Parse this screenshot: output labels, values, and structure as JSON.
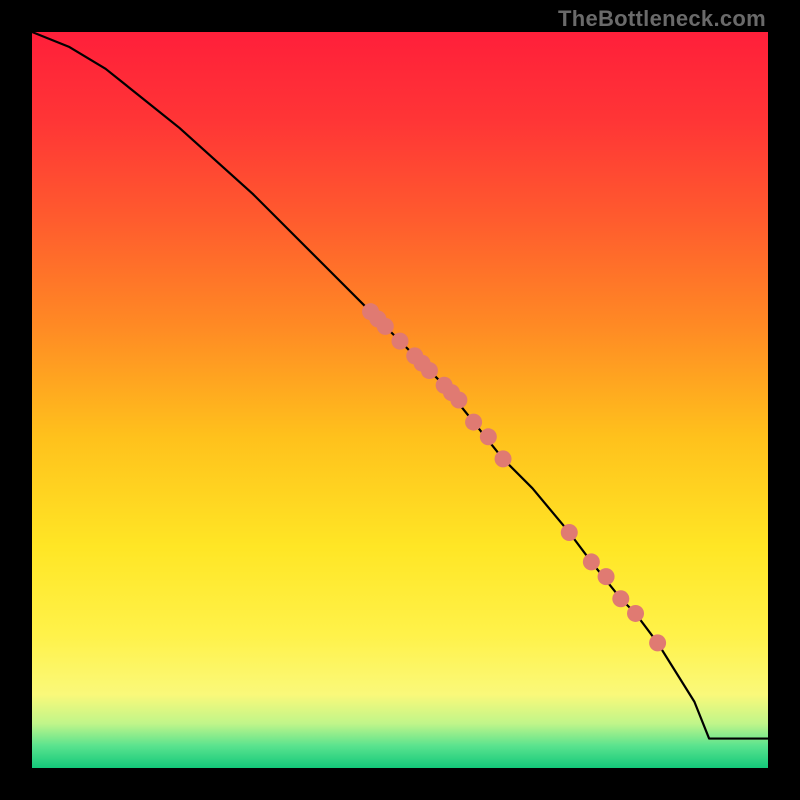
{
  "watermark": "TheBottleneck.com",
  "chart_data": {
    "type": "line",
    "title": "",
    "xlabel": "",
    "ylabel": "",
    "xlim": [
      0,
      100
    ],
    "ylim": [
      0,
      100
    ],
    "curve": {
      "x": [
        0,
        5,
        10,
        15,
        20,
        30,
        40,
        46,
        50,
        54,
        56,
        60,
        64,
        68,
        73,
        76,
        80,
        82,
        85,
        90,
        92,
        100
      ],
      "y": [
        100,
        98,
        95,
        91,
        87,
        78,
        68,
        62,
        58,
        54,
        52,
        47,
        42,
        38,
        32,
        28,
        23,
        21,
        17,
        9,
        4,
        4
      ]
    },
    "series": [
      {
        "name": "dots-cluster-upper",
        "type": "scatter",
        "color": "#e07a72",
        "x": [
          46,
          47,
          48,
          50,
          52,
          53,
          54,
          56,
          57,
          58,
          60,
          62,
          64
        ],
        "y": [
          62,
          61,
          60,
          58,
          56,
          55,
          54,
          52,
          51,
          50,
          47,
          45,
          42
        ]
      },
      {
        "name": "dots-cluster-lower",
        "type": "scatter",
        "color": "#e07a72",
        "x": [
          73,
          76,
          78,
          80,
          82,
          85
        ],
        "y": [
          32,
          28,
          26,
          23,
          21,
          17
        ]
      }
    ],
    "gradient_stops": [
      {
        "offset": 0.0,
        "color": "#ff1f3a"
      },
      {
        "offset": 0.12,
        "color": "#ff3536"
      },
      {
        "offset": 0.25,
        "color": "#ff5a2e"
      },
      {
        "offset": 0.4,
        "color": "#ff8a24"
      },
      {
        "offset": 0.55,
        "color": "#ffc11c"
      },
      {
        "offset": 0.7,
        "color": "#ffe625"
      },
      {
        "offset": 0.82,
        "color": "#fff24a"
      },
      {
        "offset": 0.9,
        "color": "#faf97a"
      },
      {
        "offset": 0.94,
        "color": "#bff58a"
      },
      {
        "offset": 0.97,
        "color": "#5ae38e"
      },
      {
        "offset": 1.0,
        "color": "#13c87a"
      }
    ]
  }
}
